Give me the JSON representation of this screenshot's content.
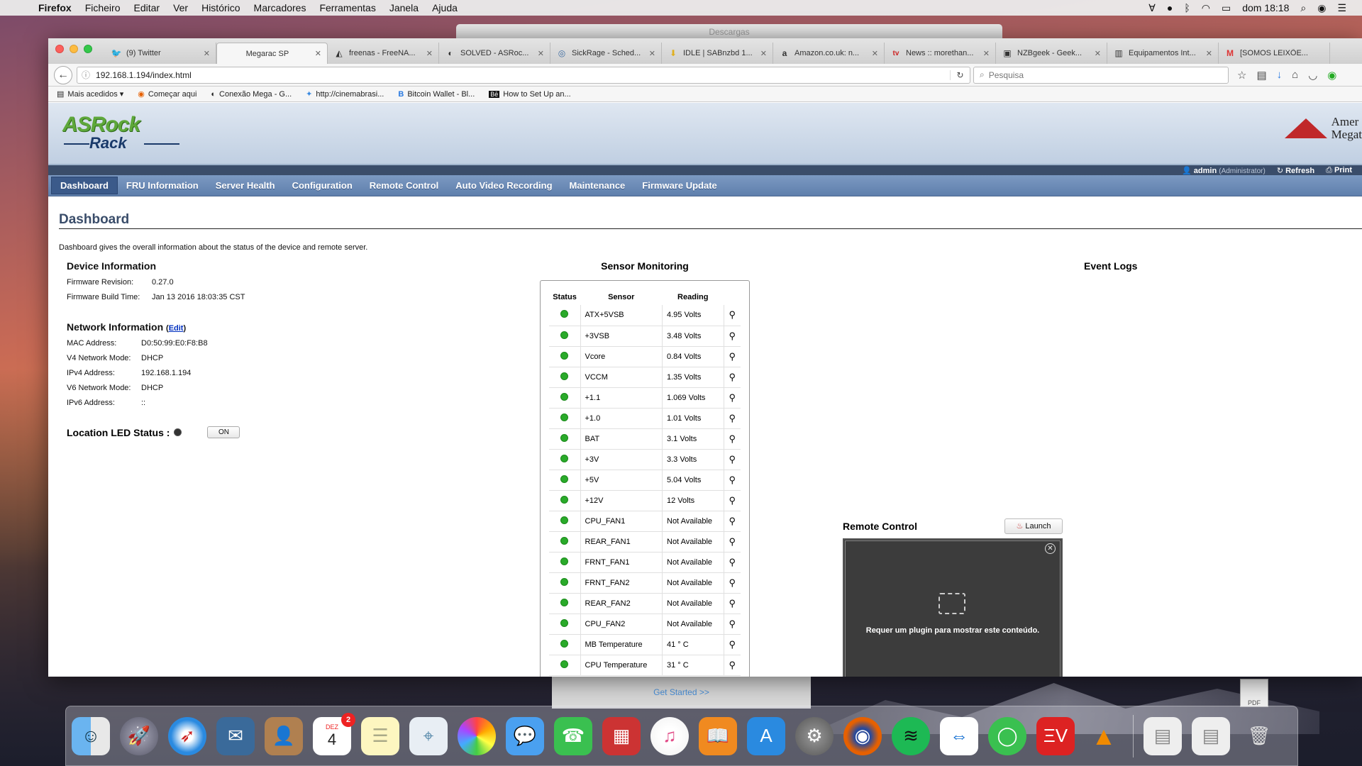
{
  "menubar": {
    "app": "Firefox",
    "items": [
      "Ficheiro",
      "Editar",
      "Ver",
      "Histórico",
      "Marcadores",
      "Ferramentas",
      "Janela",
      "Ajuda"
    ],
    "clock": "dom 18:18"
  },
  "bg_window": {
    "title": "Descargas",
    "button": "Get Started >>",
    "pdf_label": "PDF"
  },
  "tabs": [
    {
      "icon": "🐦",
      "label": "(9) Twitter"
    },
    {
      "icon": "",
      "label": "Megarac SP"
    },
    {
      "icon": "◭",
      "label": "freenas - FreeNA..."
    },
    {
      "icon": "◐",
      "label": "SOLVED - ASRoc..."
    },
    {
      "icon": "◎",
      "label": "SickRage - Sched..."
    },
    {
      "icon": "⬇",
      "label": "IDLE | SABnzbd 1..."
    },
    {
      "icon": "a",
      "label": "Amazon.co.uk: n..."
    },
    {
      "icon": "tv",
      "label": "News :: morethan..."
    },
    {
      "icon": "▣",
      "label": "NZBgeek - Geek..."
    },
    {
      "icon": "▥",
      "label": "Equipamentos Int..."
    },
    {
      "icon": "M",
      "label": "[SOMOS LEIXÕE..."
    }
  ],
  "url": "192.168.1.194/index.html",
  "search_placeholder": "Pesquisa",
  "bookmarks": [
    {
      "icon": "▤",
      "label": "Mais acedidos ▾"
    },
    {
      "icon": "◉",
      "label": "Começar aqui"
    },
    {
      "icon": "◐",
      "label": "Conexão Mega - G..."
    },
    {
      "icon": "✦",
      "label": "http://cinemabrasi..."
    },
    {
      "icon": "B",
      "label": "Bitcoin Wallet - Bl..."
    },
    {
      "icon": "Bē",
      "label": "How to Set Up an..."
    }
  ],
  "header": {
    "logo_top": "ASRock",
    "logo_bottom": "Rack",
    "ami_l1": "Amer",
    "ami_l2": "Megat"
  },
  "userbar": {
    "user": "admin",
    "role": "(Administrator)",
    "refresh": "Refresh",
    "print": "Print"
  },
  "nav": [
    "Dashboard",
    "FRU Information",
    "Server Health",
    "Configuration",
    "Remote Control",
    "Auto Video Recording",
    "Maintenance",
    "Firmware Update"
  ],
  "page": {
    "title": "Dashboard",
    "description": "Dashboard gives the overall information about the status of the device and remote server."
  },
  "device": {
    "heading": "Device Information",
    "fw_rev_label": "Firmware Revision:",
    "fw_rev": "0.27.0",
    "fw_build_label": "Firmware Build Time:",
    "fw_build": "Jan 13 2016 18:03:35 CST"
  },
  "network": {
    "heading": "Network Information",
    "edit": "Edit",
    "rows": [
      {
        "k": "MAC Address:",
        "v": "D0:50:99:E0:F8:B8"
      },
      {
        "k": "V4 Network Mode:",
        "v": "DHCP"
      },
      {
        "k": "IPv4 Address:",
        "v": "192.168.1.194"
      },
      {
        "k": "V6 Network Mode:",
        "v": "DHCP"
      },
      {
        "k": "IPv6 Address:",
        "v": "::"
      }
    ]
  },
  "led": {
    "label": "Location LED Status :",
    "button": "ON"
  },
  "sensors": {
    "heading": "Sensor Monitoring",
    "col_status": "Status",
    "col_sensor": "Sensor",
    "col_reading": "Reading",
    "rows": [
      {
        "name": "ATX+5VSB",
        "reading": "4.95 Volts"
      },
      {
        "name": "+3VSB",
        "reading": "3.48 Volts"
      },
      {
        "name": "Vcore",
        "reading": "0.84 Volts"
      },
      {
        "name": "VCCM",
        "reading": "1.35 Volts"
      },
      {
        "name": "+1.1",
        "reading": "1.069 Volts"
      },
      {
        "name": "+1.0",
        "reading": "1.01 Volts"
      },
      {
        "name": "BAT",
        "reading": "3.1 Volts"
      },
      {
        "name": "+3V",
        "reading": "3.3 Volts"
      },
      {
        "name": "+5V",
        "reading": "5.04 Volts"
      },
      {
        "name": "+12V",
        "reading": "12 Volts"
      },
      {
        "name": "CPU_FAN1",
        "reading": "Not Available"
      },
      {
        "name": "REAR_FAN1",
        "reading": "Not Available"
      },
      {
        "name": "FRNT_FAN1",
        "reading": "Not Available"
      },
      {
        "name": "FRNT_FAN2",
        "reading": "Not Available"
      },
      {
        "name": "REAR_FAN2",
        "reading": "Not Available"
      },
      {
        "name": "CPU_FAN2",
        "reading": "Not Available"
      },
      {
        "name": "MB Temperature",
        "reading": "41 ° C"
      },
      {
        "name": "CPU Temperature",
        "reading": "31 ° C"
      }
    ]
  },
  "events": {
    "heading": "Event Logs"
  },
  "remote": {
    "heading": "Remote Control",
    "launch": "Launch",
    "plugin_msg": "Requer um plugin para mostrar este conteúdo."
  },
  "dock": {
    "calendar_month": "DEZ",
    "calendar_day": "4",
    "calendar_badge": "2"
  }
}
